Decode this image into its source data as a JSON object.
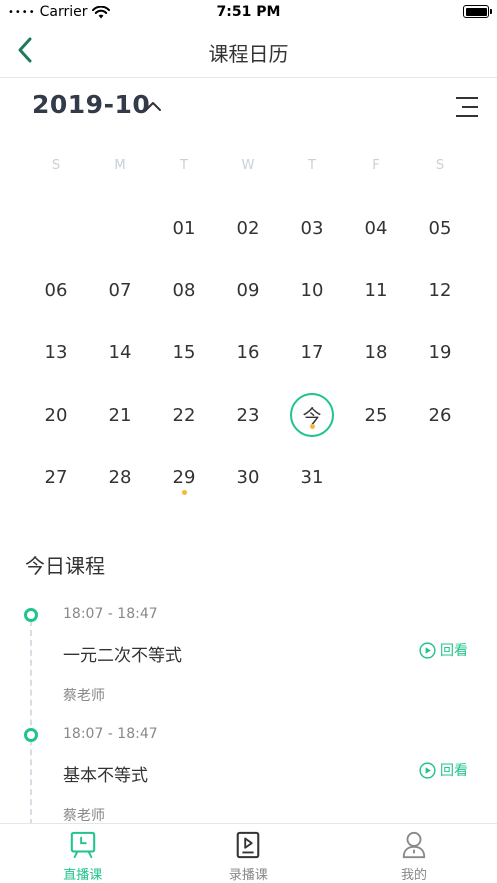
{
  "status_bar": {
    "signal_dots": "••••",
    "carrier": "Carrier",
    "wifi_icon": "wifi-icon",
    "time": "7:51 PM",
    "battery_icon": "battery-icon"
  },
  "nav": {
    "back_icon": "chevron-left-icon",
    "title": "课程日历"
  },
  "calendar": {
    "month": "2019-10",
    "month_toggle_icon": "chevron-up-icon",
    "menu_icon": "menu-icon",
    "weekdays": [
      "S",
      "M",
      "T",
      "W",
      "T",
      "F",
      "S"
    ],
    "leading_blanks": 2,
    "days": [
      "01",
      "02",
      "03",
      "04",
      "05",
      "06",
      "07",
      "08",
      "09",
      "10",
      "11",
      "12",
      "13",
      "14",
      "15",
      "16",
      "17",
      "18",
      "19",
      "20",
      "21",
      "22",
      "23",
      "今",
      "25",
      "26",
      "27",
      "28",
      "29",
      "30",
      "31"
    ],
    "today_label": "今",
    "marked_days": [
      "29",
      "今"
    ],
    "accent_color": "#20c48a",
    "dot_color": "#f3b93a"
  },
  "courses_section": {
    "title": "今日课程",
    "items": [
      {
        "time": "18:07 - 18:47",
        "title": "一元二次不等式",
        "teacher": "蔡老师",
        "action": "回看"
      },
      {
        "time": "18:07 - 18:47",
        "title": "基本不等式",
        "teacher": "蔡老师",
        "action": "回看"
      }
    ]
  },
  "tab_bar": {
    "tabs": [
      {
        "label": "直播课",
        "icon": "live-class-icon",
        "active": true
      },
      {
        "label": "录播课",
        "icon": "recorded-class-icon",
        "active": false
      },
      {
        "label": "我的",
        "icon": "profile-icon",
        "active": false
      }
    ]
  }
}
